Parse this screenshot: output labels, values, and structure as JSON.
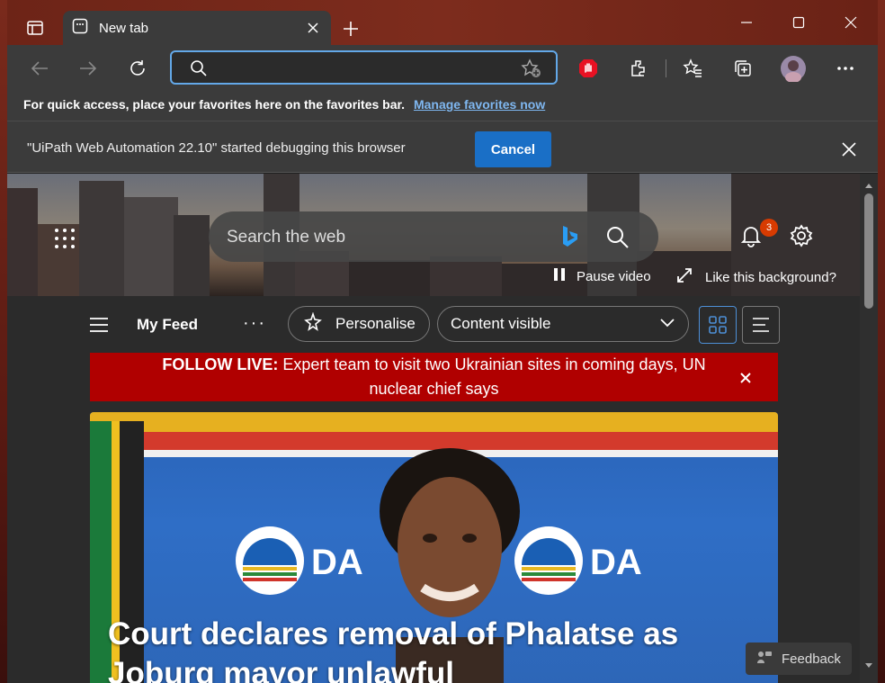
{
  "tab": {
    "title": "New tab"
  },
  "address": {
    "value": "",
    "placeholder": ""
  },
  "favorites_bar": {
    "message": "For quick access, place your favorites here on the favorites bar.",
    "link": "Manage favorites now"
  },
  "debug_bar": {
    "message": "\"UiPath Web Automation 22.10\" started debugging this browser",
    "cancel_label": "Cancel"
  },
  "newtab": {
    "search_placeholder": "Search the web",
    "notification_count": "3",
    "pause_label": "Pause video",
    "like_label": "Like this background?"
  },
  "feed": {
    "title": "My Feed",
    "more": "···",
    "personalise_label": "Personalise",
    "content_select": "Content visible"
  },
  "alert": {
    "prefix": "FOLLOW LIVE:",
    "text": "Expert team to visit two Ukrainian sites in coming days, UN nuclear chief says"
  },
  "hero_story": {
    "headline": "Court declares removal of Phalatse as Joburg mayor unlawful",
    "logo_text": "DA"
  },
  "feedback_label": "Feedback",
  "colors": {
    "accent": "#1a6fc6",
    "alert": "#b00000",
    "frame": "#7d2c1d"
  }
}
